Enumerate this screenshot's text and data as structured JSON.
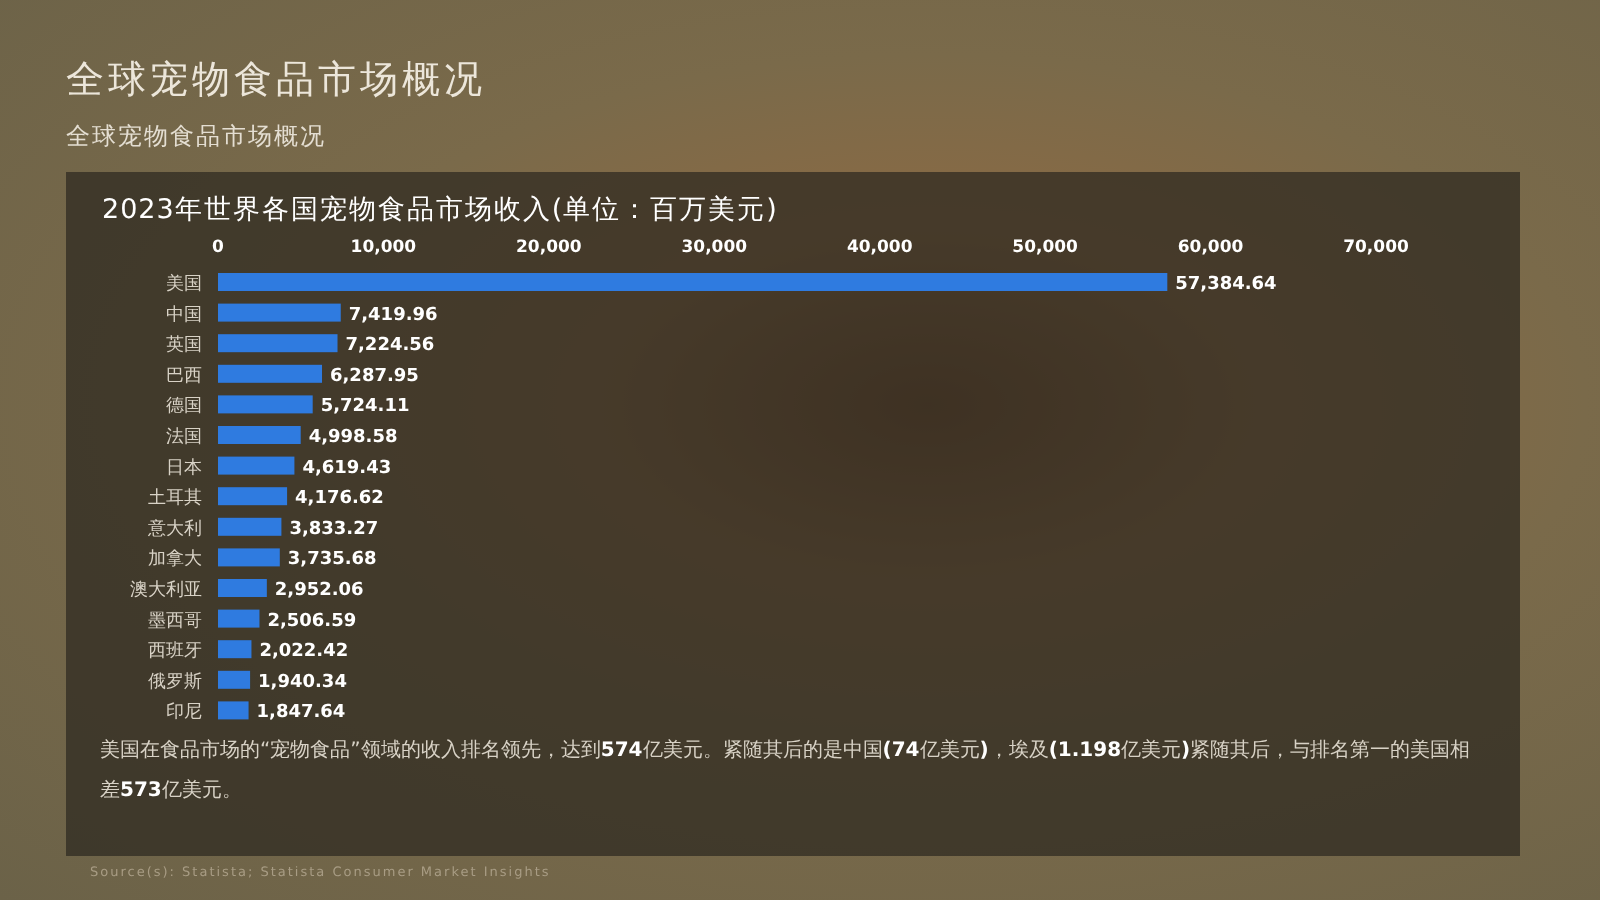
{
  "page": {
    "title": "全球宠物食品市场概况",
    "subtitle": "全球宠物食品市场概况"
  },
  "chart_panel": {
    "title": "2023年世界各国宠物食品市场收入(单位：百万美元)",
    "chart_data": {
      "type": "bar",
      "orientation": "horizontal",
      "value_labels": [
        "57,384.64",
        "7,419.96",
        "7,224.56",
        "6,287.95",
        "5,724.11",
        "4,998.58",
        "4,619.43",
        "4,176.62",
        "3,833.27",
        "3,735.68",
        "2,952.06",
        "2,506.59",
        "2,022.42",
        "1,940.34",
        "1,847.64"
      ],
      "xlim": [
        0,
        70000
      ],
      "xticks": [
        {
          "value": 0,
          "label": "0"
        },
        {
          "value": 10000,
          "label": "10,000"
        },
        {
          "value": 20000,
          "label": "20,000"
        },
        {
          "value": 30000,
          "label": "30,000"
        },
        {
          "value": 40000,
          "label": "40,000"
        },
        {
          "value": 50000,
          "label": "50,000"
        },
        {
          "value": 60000,
          "label": "60,000"
        },
        {
          "value": 70000,
          "label": "70,000"
        }
      ],
      "categories": [
        "美国",
        "中国",
        "英国",
        "巴西",
        "德国",
        "法国",
        "日本",
        "土耳其",
        "意大利",
        "加拿大",
        "澳大利亚",
        "墨西哥",
        "西班牙",
        "俄罗斯",
        "印尼"
      ],
      "series": [
        {
          "color": "#2f7be0",
          "values": [
            57384.64,
            7419.96,
            7224.56,
            6287.95,
            5724.11,
            4998.58,
            4619.43,
            4176.62,
            3833.27,
            3735.68,
            2952.06,
            2506.59,
            2022.42,
            1940.34,
            1847.64
          ]
        }
      ]
    },
    "summary": "美国在食品市场的“宠物食品”领域的收入排名领先，达到**574**亿美元。紧随其后的是中国**(74**亿美元**)**，埃及**(1.198**亿美元**)**紧随其后，与排名第一的美国相差**573**亿美元。"
  },
  "source": "Source(s): Statista; Statista Consumer Market Insights"
}
